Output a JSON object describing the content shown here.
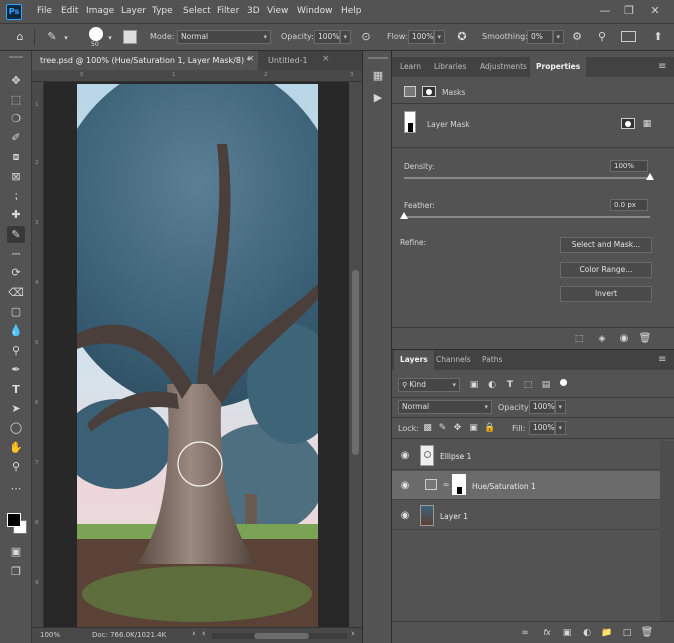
{
  "app": {
    "logo": "Ps",
    "menu": [
      "File",
      "Edit",
      "Image",
      "Layer",
      "Type",
      "Select",
      "Filter",
      "3D",
      "View",
      "Window",
      "Help"
    ],
    "window_controls": [
      "minimize",
      "restore",
      "close"
    ]
  },
  "options_bar": {
    "brush_size": "50",
    "mode_label": "Mode:",
    "mode_value": "Normal",
    "opacity_label": "Opacity:",
    "opacity_value": "100%",
    "flow_label": "Flow:",
    "flow_value": "100%",
    "smoothing_label": "Smoothing:",
    "smoothing_value": "0%"
  },
  "tools": [
    "move-tool",
    "marquee-tool",
    "lasso-tool",
    "quick-select-tool",
    "crop-tool",
    "frame-tool",
    "eyedropper-tool",
    "healing-tool",
    "brush-tool",
    "stamp-tool",
    "history-brush-tool",
    "eraser-tool",
    "gradient-tool",
    "blur-tool",
    "dodge-tool",
    "pen-tool",
    "type-tool",
    "path-select-tool",
    "shape-tool",
    "hand-tool",
    "zoom-tool",
    "more-tools"
  ],
  "document": {
    "tabs": [
      {
        "label": "tree.psd @ 100% (Hue/Saturation 1, Layer Mask/8) *",
        "active": true
      },
      {
        "label": "Untitled-1",
        "active": false
      }
    ],
    "ruler_left_ticks": [
      "1",
      "2",
      "3",
      "4",
      "5",
      "6",
      "7",
      "8",
      "9"
    ],
    "ruler_top_ticks": [
      "0",
      "1",
      "2",
      "3"
    ],
    "zoom": "100%",
    "doc_size": "Doc: 766.0K/1021.4K"
  },
  "properties": {
    "tabs": [
      "Learn",
      "Libraries",
      "Adjustments",
      "Properties"
    ],
    "active_tab": "Properties",
    "header": "Masks",
    "mask_type": "Layer Mask",
    "density_label": "Density:",
    "density_value": "100%",
    "density_level": 1.0,
    "feather_label": "Feather:",
    "feather_value": "0.0 px",
    "feather_level": 0.0,
    "refine_label": "Refine:",
    "buttons": [
      "Select and Mask...",
      "Color Range...",
      "Invert"
    ]
  },
  "layers": {
    "tabs": [
      "Layers",
      "Channels",
      "Paths"
    ],
    "active_tab": "Layers",
    "filter_kind": "Kind",
    "blend_mode": "Normal",
    "opacity_label": "Opacity:",
    "opacity_value": "100%",
    "lock_label": "Lock:",
    "fill_label": "Fill:",
    "fill_value": "100%",
    "items": [
      {
        "name": "Ellipse 1",
        "selected": false
      },
      {
        "name": "Hue/Saturation 1",
        "selected": true
      },
      {
        "name": "Layer 1",
        "selected": false
      }
    ]
  },
  "colors": {
    "accent": "#31a8ff",
    "panel_bg": "#535353",
    "canvas_bg": "#282828",
    "selected_row": "#6b6b6b"
  }
}
